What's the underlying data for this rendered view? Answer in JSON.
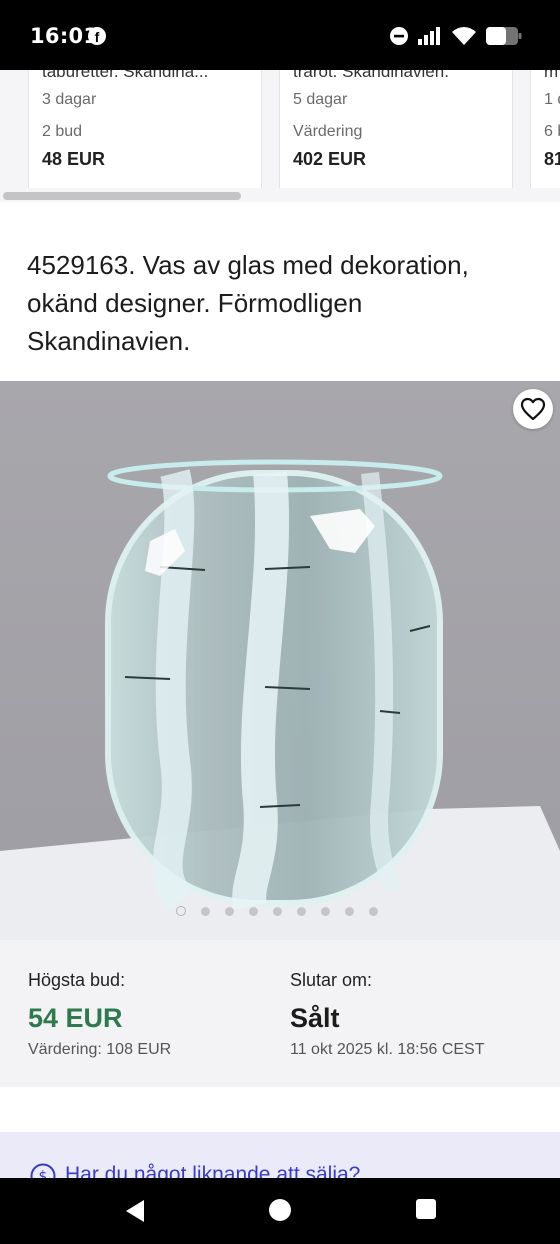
{
  "status_bar": {
    "time": "16:01",
    "fb_glyph": "f"
  },
  "related_items": [
    {
      "title": "taburetter. Skandina...",
      "time_left": "3 dagar",
      "bid_label": "2 bud",
      "price": "48 EUR"
    },
    {
      "title": "trarot. Skandinavien.",
      "time_left": "5 dagar",
      "bid_label": "Värdering",
      "price": "402 EUR"
    },
    {
      "title": "m",
      "time_left": "1 d",
      "bid_label": "6 b",
      "price": "81"
    }
  ],
  "lot": {
    "title": "4529163. Vas av glas med dekoration, okänd designer. Förmodligen Skandinavien.",
    "image_count": 9,
    "active_image_index": 0
  },
  "bid": {
    "highest_label": "Högsta bud:",
    "highest_value": "54 EUR",
    "estimate": "Värdering: 108 EUR",
    "ends_label": "Slutar om:",
    "ends_value": "Sålt",
    "ends_date": "11 okt 2025 kl. 18:56 CEST"
  },
  "sell_banner": {
    "text": "Har du något liknande att sälja?"
  },
  "colors": {
    "accent_green": "#2e7a4e",
    "link_blue": "#3b3dbf",
    "banner_bg": "#ebeaf8"
  }
}
